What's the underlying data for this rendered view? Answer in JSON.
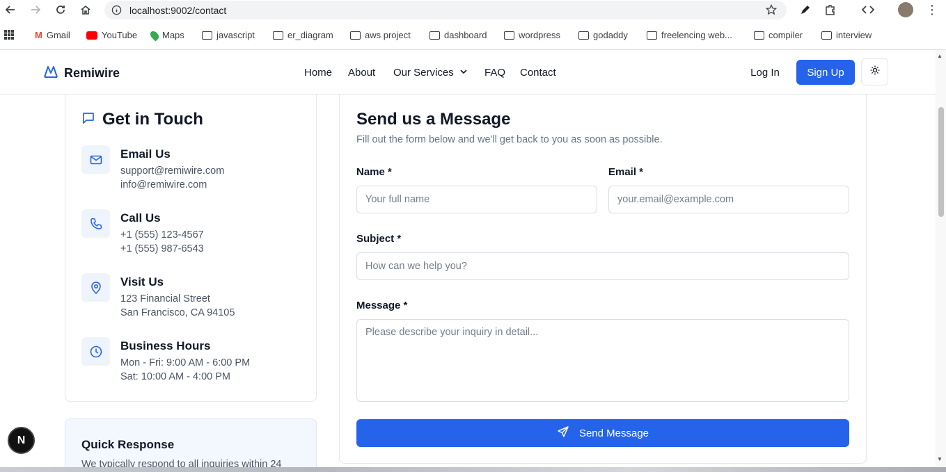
{
  "browser": {
    "url": "localhost:9002/contact",
    "bookmarks": [
      "Gmail",
      "YouTube",
      "Maps",
      "javascript",
      "er_diagram",
      "aws project",
      "dashboard",
      "wordpress",
      "godaddy",
      "freelencing web...",
      "compiler",
      "interview"
    ]
  },
  "header": {
    "brand": "Remiwire",
    "nav": [
      "Home",
      "About",
      "Our Services",
      "FAQ",
      "Contact"
    ],
    "login_label": "Log In",
    "signup_label": "Sign Up",
    "accent_color": "#2563eb"
  },
  "contact_info": {
    "title": "Get in Touch",
    "items": [
      {
        "icon": "mail-icon",
        "heading": "Email Us",
        "line1": "support@remiwire.com",
        "line2": "info@remiwire.com"
      },
      {
        "icon": "phone-icon",
        "heading": "Call Us",
        "line1": "+1 (555) 123-4567",
        "line2": "+1 (555) 987-6543"
      },
      {
        "icon": "map-pin-icon",
        "heading": "Visit Us",
        "line1": "123 Financial Street",
        "line2": "San Francisco, CA 94105"
      },
      {
        "icon": "clock-icon",
        "heading": "Business Hours",
        "line1": "Mon - Fri: 9:00 AM - 6:00 PM",
        "line2": "Sat: 10:00 AM - 4:00 PM"
      }
    ]
  },
  "quick_response": {
    "title": "Quick Response",
    "text": "We typically respond to all inquiries within 24"
  },
  "form": {
    "title": "Send us a Message",
    "subtitle": "Fill out the form below and we'll get back to you as soon as possible.",
    "name_label": "Name *",
    "name_placeholder": "Your full name",
    "email_label": "Email *",
    "email_placeholder": "your.email@example.com",
    "subject_label": "Subject *",
    "subject_placeholder": "How can we help you?",
    "message_label": "Message *",
    "message_placeholder": "Please describe your inquiry in detail...",
    "submit_label": "Send Message"
  },
  "dev_badge": "N"
}
